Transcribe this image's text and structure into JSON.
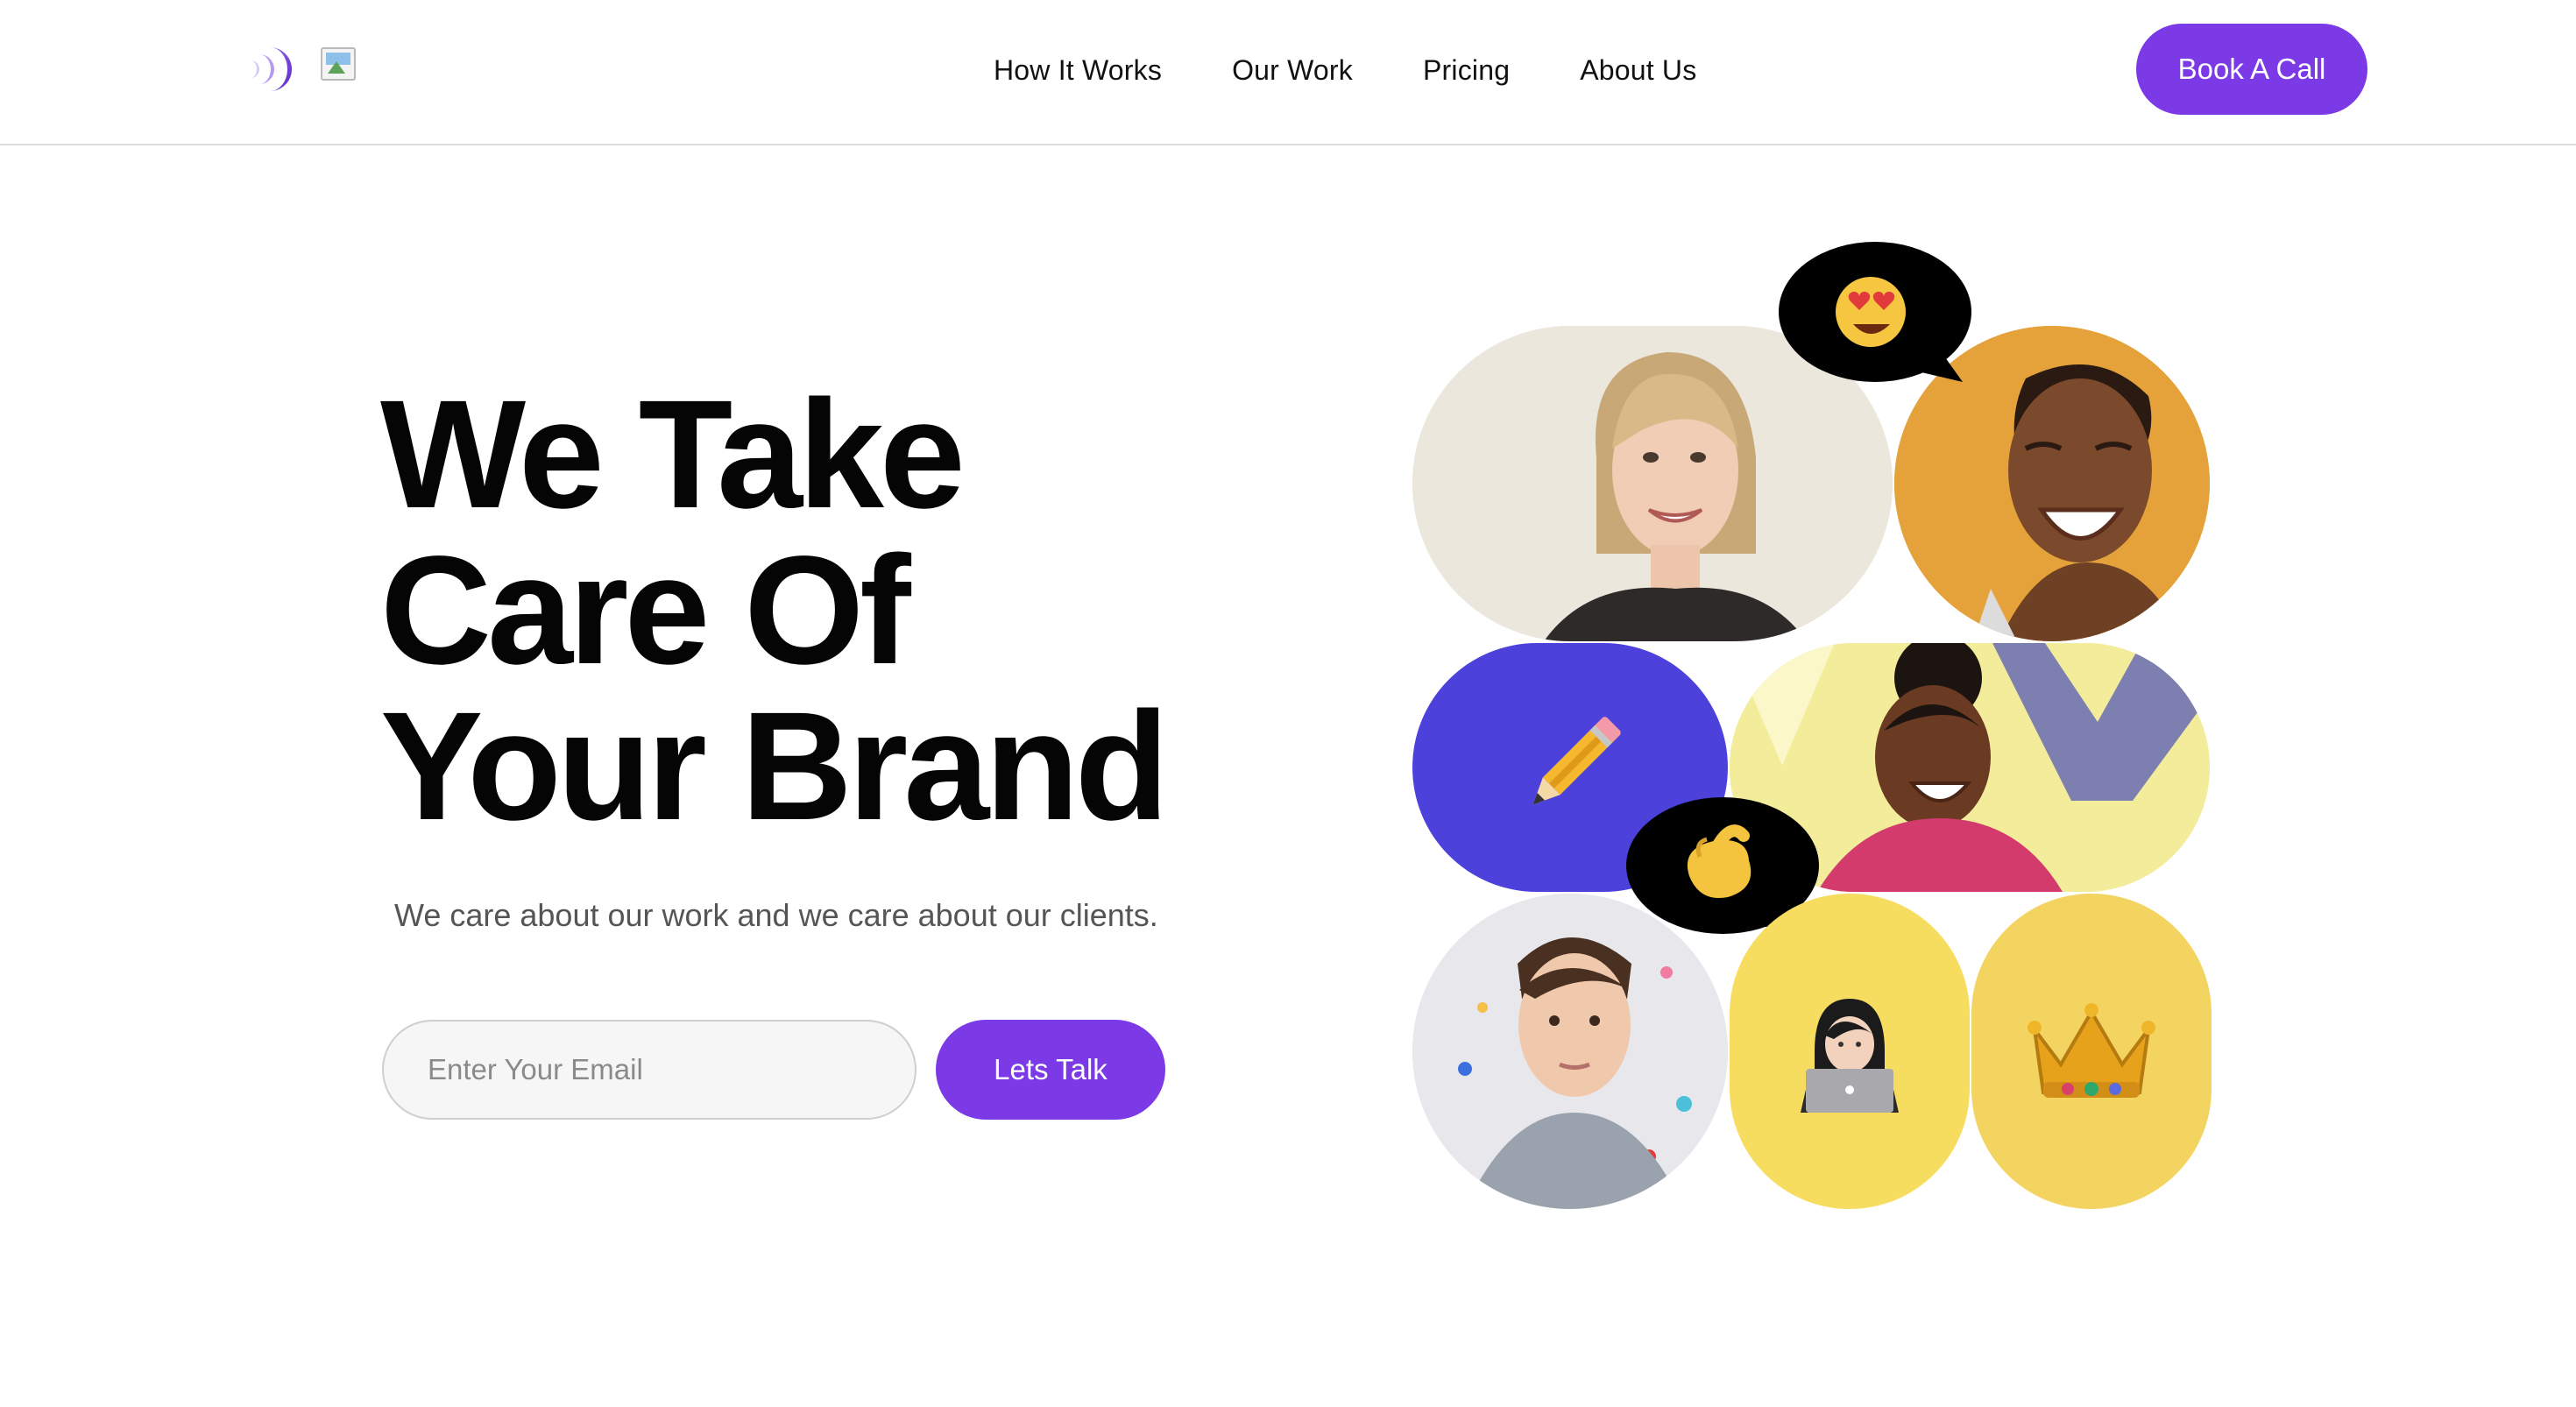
{
  "header": {
    "logo_icon": "crescent-waves-logo",
    "broken_image_icon": "broken-image-icon",
    "nav": [
      {
        "label": "How It Works"
      },
      {
        "label": "Our Work"
      },
      {
        "label": "Pricing"
      },
      {
        "label": "About Us"
      }
    ],
    "cta_label": "Book A Call"
  },
  "hero": {
    "title_lines": [
      "We Take",
      "Care Of",
      "Your Brand"
    ],
    "subtitle": "We care about our work and we care about our clients.",
    "email_placeholder": "Enter Your Email",
    "submit_label": "Lets Talk"
  },
  "collage": {
    "tiles": [
      {
        "kind": "photo",
        "icon": "smiling-woman-photo",
        "bg": "#ece7dd"
      },
      {
        "kind": "photo",
        "icon": "laughing-woman-photo",
        "bg": "#e6a23a"
      },
      {
        "kind": "emoji",
        "icon": "pencil-icon",
        "bg": "#4d41dc"
      },
      {
        "kind": "photo",
        "icon": "laughing-girl-photo",
        "bg": "#f3ec9a"
      },
      {
        "kind": "photo",
        "icon": "young-man-photo",
        "bg": "#e8e8ec"
      },
      {
        "kind": "emoji",
        "icon": "woman-technologist-icon",
        "bg": "#f7dd5f"
      },
      {
        "kind": "emoji",
        "icon": "crown-icon",
        "bg": "#f4d460"
      }
    ],
    "bubbles": [
      {
        "icon": "heart-eyes-emoji-icon",
        "bg": "#000000"
      },
      {
        "icon": "pinching-hand-emoji-icon",
        "bg": "#000000"
      }
    ]
  },
  "colors": {
    "accent": "#7b3ae6",
    "divider": "#dcdcdc",
    "text": "#050505",
    "muted": "#555555"
  }
}
